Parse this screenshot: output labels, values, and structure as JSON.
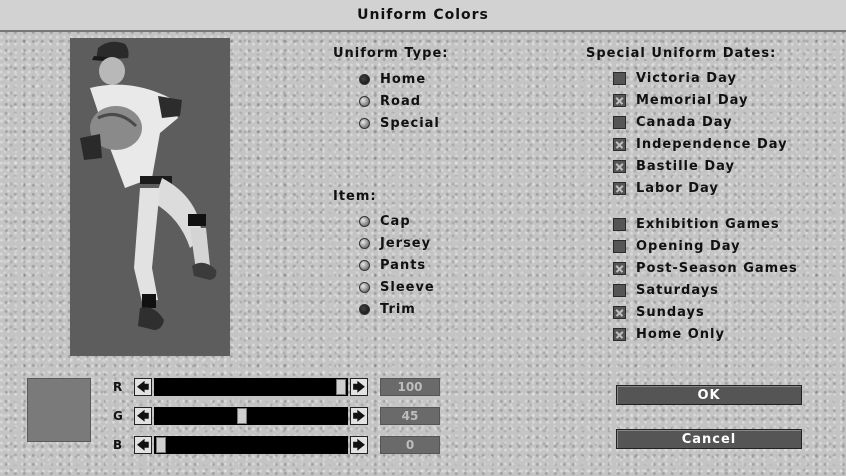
{
  "window": {
    "title": "Uniform Colors"
  },
  "uniform_type": {
    "heading": "Uniform Type:",
    "options": [
      {
        "label": "Home",
        "selected": true
      },
      {
        "label": "Road",
        "selected": false
      },
      {
        "label": "Special",
        "selected": false
      }
    ]
  },
  "item": {
    "heading": "Item:",
    "options": [
      {
        "label": "Cap",
        "selected": false
      },
      {
        "label": "Jersey",
        "selected": false
      },
      {
        "label": "Pants",
        "selected": false
      },
      {
        "label": "Sleeve",
        "selected": false
      },
      {
        "label": "Trim",
        "selected": true
      }
    ]
  },
  "special_dates": {
    "heading": "Special Uniform Dates:",
    "items": [
      {
        "label": "Victoria Day",
        "checked": false
      },
      {
        "label": "Memorial Day",
        "checked": true
      },
      {
        "label": "Canada Day",
        "checked": false
      },
      {
        "label": "Independence Day",
        "checked": true
      },
      {
        "label": "Bastille Day",
        "checked": true
      },
      {
        "label": "Labor Day",
        "checked": true
      },
      {
        "label": "Exhibition Games",
        "checked": false
      },
      {
        "label": "Opening Day",
        "checked": false
      },
      {
        "label": "Post-Season Games",
        "checked": true
      },
      {
        "label": "Saturdays",
        "checked": false
      },
      {
        "label": "Sundays",
        "checked": true
      },
      {
        "label": "Home Only",
        "checked": true
      }
    ]
  },
  "color": {
    "swatch": "#7a7a7a",
    "sliders": [
      {
        "label": "R",
        "value": "100",
        "max": 100,
        "level": 100
      },
      {
        "label": "G",
        "value": "45",
        "max": 100,
        "level": 45
      },
      {
        "label": "B",
        "value": "0",
        "max": 100,
        "level": 0
      }
    ],
    "left_arrow": "🡄",
    "right_arrow": "🡆"
  },
  "buttons": {
    "ok": "OK",
    "cancel": "Cancel"
  }
}
